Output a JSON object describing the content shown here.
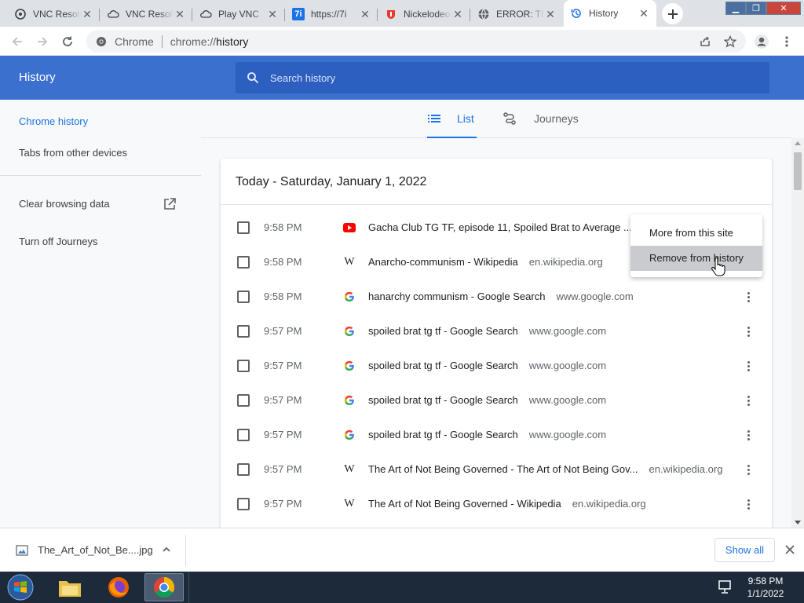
{
  "tabs": [
    {
      "title": "VNC Resolution",
      "icon": "vnc-icon"
    },
    {
      "title": "VNC Resolution",
      "icon": "cloud-icon"
    },
    {
      "title": "Play VNC",
      "icon": "cloud-icon"
    },
    {
      "title": "https://7i",
      "icon": "7i-icon"
    },
    {
      "title": "Nickelodeon",
      "icon": "nickelodeon-icon"
    },
    {
      "title": "ERROR: Th",
      "icon": "globe-icon"
    },
    {
      "title": "History",
      "icon": "history-icon"
    }
  ],
  "toolbar": {
    "chrome_label": "Chrome",
    "url_scheme": "chrome://",
    "url_path": "history"
  },
  "header": {
    "title": "History",
    "search_placeholder": "Search history"
  },
  "sidebar": {
    "items": [
      {
        "label": "Chrome history"
      },
      {
        "label": "Tabs from other devices"
      },
      {
        "label": "Clear browsing data"
      },
      {
        "label": "Turn off Journeys"
      }
    ]
  },
  "view_tabs": [
    {
      "label": "List"
    },
    {
      "label": "Journeys"
    }
  ],
  "history": {
    "date_heading": "Today - Saturday, January 1, 2022",
    "entries": [
      {
        "time": "9:58 PM",
        "icon": "youtube-icon",
        "title": "Gacha Club TG TF, episode 11, Spoiled Brat to Average ...",
        "domain": ""
      },
      {
        "time": "9:58 PM",
        "icon": "wikipedia-icon",
        "title": "Anarcho-communism - Wikipedia",
        "domain": "en.wikipedia.org"
      },
      {
        "time": "9:58 PM",
        "icon": "google-icon",
        "title": "hanarchy communism - Google Search",
        "domain": "www.google.com"
      },
      {
        "time": "9:57 PM",
        "icon": "google-icon",
        "title": "spoiled brat tg tf - Google Search",
        "domain": "www.google.com"
      },
      {
        "time": "9:57 PM",
        "icon": "google-icon",
        "title": "spoiled brat tg tf - Google Search",
        "domain": "www.google.com"
      },
      {
        "time": "9:57 PM",
        "icon": "google-icon",
        "title": "spoiled brat tg tf - Google Search",
        "domain": "www.google.com"
      },
      {
        "time": "9:57 PM",
        "icon": "google-icon",
        "title": "spoiled brat tg tf - Google Search",
        "domain": "www.google.com"
      },
      {
        "time": "9:57 PM",
        "icon": "wikipedia-icon",
        "title": "The Art of Not Being Governed - The Art of Not Being Gov...",
        "domain": "en.wikipedia.org"
      },
      {
        "time": "9:57 PM",
        "icon": "wikipedia-icon",
        "title": "The Art of Not Being Governed - Wikipedia",
        "domain": "en.wikipedia.org"
      }
    ]
  },
  "context_menu": {
    "items": [
      {
        "label": "More from this site"
      },
      {
        "label": "Remove from history"
      }
    ]
  },
  "download_bar": {
    "file_name": "The_Art_of_Not_Be....jpg",
    "show_all_label": "Show all"
  },
  "taskbar": {
    "time": "9:58 PM",
    "date": "1/1/2022"
  },
  "colors": {
    "header_blue": "#3b70cf",
    "accent_blue": "#1a73e8"
  }
}
